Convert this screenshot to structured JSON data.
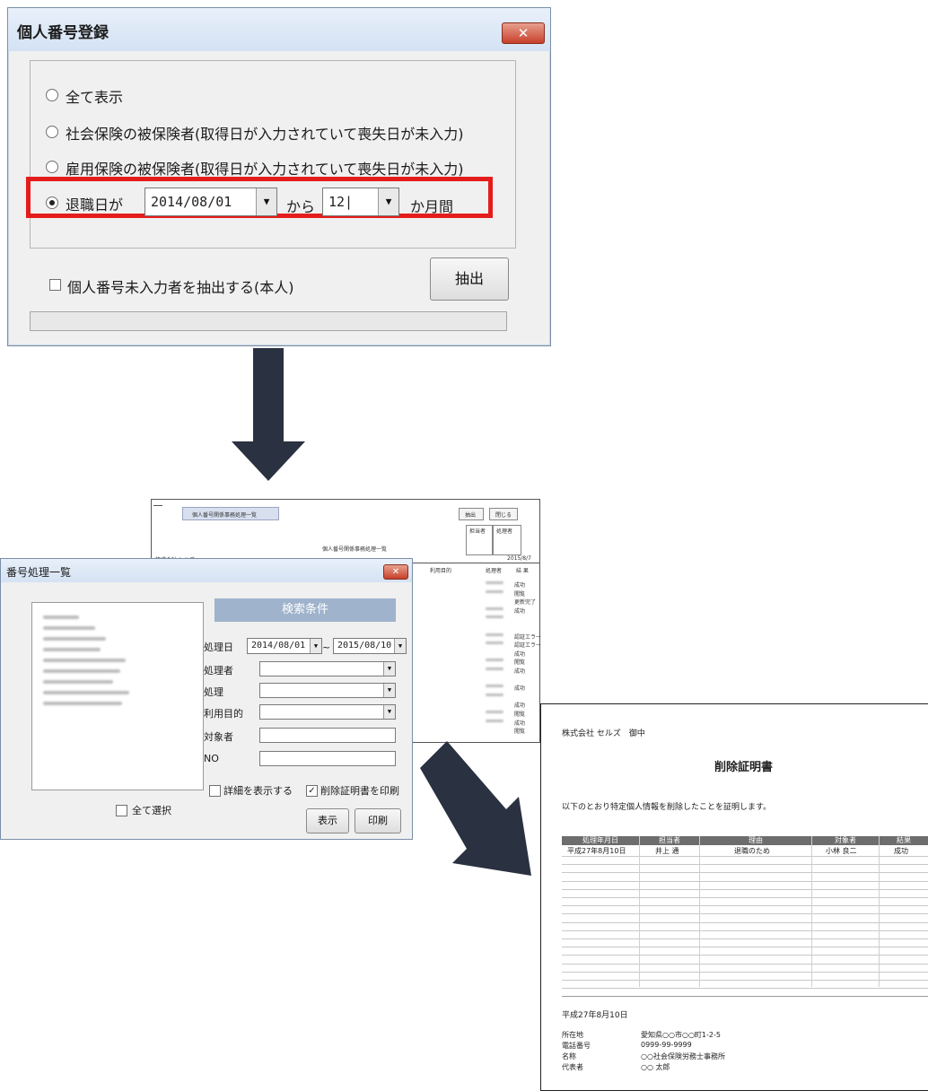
{
  "dialog1": {
    "title": "個人番号登録",
    "close_glyph": "✕",
    "radios": [
      {
        "label": "全て表示",
        "selected": false
      },
      {
        "label": "社会保険の被保険者(取得日が入力されていて喪失日が未入力)",
        "selected": false
      },
      {
        "label": "雇用保険の被保険者(取得日が入力されていて喪失日が未入力)",
        "selected": false
      },
      {
        "label": "退職日が",
        "selected": true
      }
    ],
    "retire_date": "2014/08/01",
    "from_label": "から",
    "months_value": "12|",
    "months_suffix": "か月間",
    "checkbox_label": "個人番号未入力者を抽出する(本人)",
    "extract_button": "抽出",
    "highlight_color": "#e51c1c"
  },
  "back_window": {
    "tab_label": "個人番号関係事務処理一覧",
    "extract_button": "抽出",
    "close_button": "閉じる",
    "header_cells": [
      "担当者",
      "処理者"
    ],
    "report_title": "個人番号関係事務処理一覧",
    "company": "株式会社 セルズ",
    "date": "2015/8/7",
    "col_purpose": "利用目的",
    "col_processor": "処理者",
    "col_result": "結 果",
    "results": [
      "成功",
      "閲覧",
      "更新完了",
      "成功",
      "",
      "",
      "認証エラー",
      "認証エラー",
      "成功",
      "閲覧",
      "成功",
      "",
      "成功",
      "",
      "成功",
      "閲覧",
      "成功",
      "閲覧"
    ]
  },
  "dialog2": {
    "title": "番号処理一覧",
    "close_glyph": "✕",
    "search_header": "検索条件",
    "date_label": "処理日",
    "date_from": "2014/08/01",
    "date_sep": "~",
    "date_to": "2015/08/10",
    "processor_label": "処理者",
    "process_label": "処理",
    "purpose_label": "利用目的",
    "target_label": "対象者",
    "no_label": "NO",
    "show_detail_label": "詳細を表示する",
    "print_cert_label": "削除証明書を印刷",
    "select_all_label": "全て選択",
    "show_button": "表示",
    "print_button": "印刷"
  },
  "certificate": {
    "addressee": "株式会社 セルズ　御中",
    "title": "削除証明書",
    "statement": "以下のとおり特定個人情報を削除したことを証明します。",
    "columns": [
      "処理年月日",
      "担当者",
      "理由",
      "対象者",
      "結果"
    ],
    "row": [
      "平成27年8月10日",
      "井上 通",
      "退職のため",
      "小林 良二",
      "成功"
    ],
    "issue_date": "平成27年8月10日",
    "info_labels": [
      "所在地",
      "電話番号",
      "名称",
      "代表者"
    ],
    "info_values": [
      "愛知県○○市○○町1-2-5",
      "0999-99-9999",
      "○○社会保険労務士事務所",
      "○○ 太郎"
    ]
  }
}
